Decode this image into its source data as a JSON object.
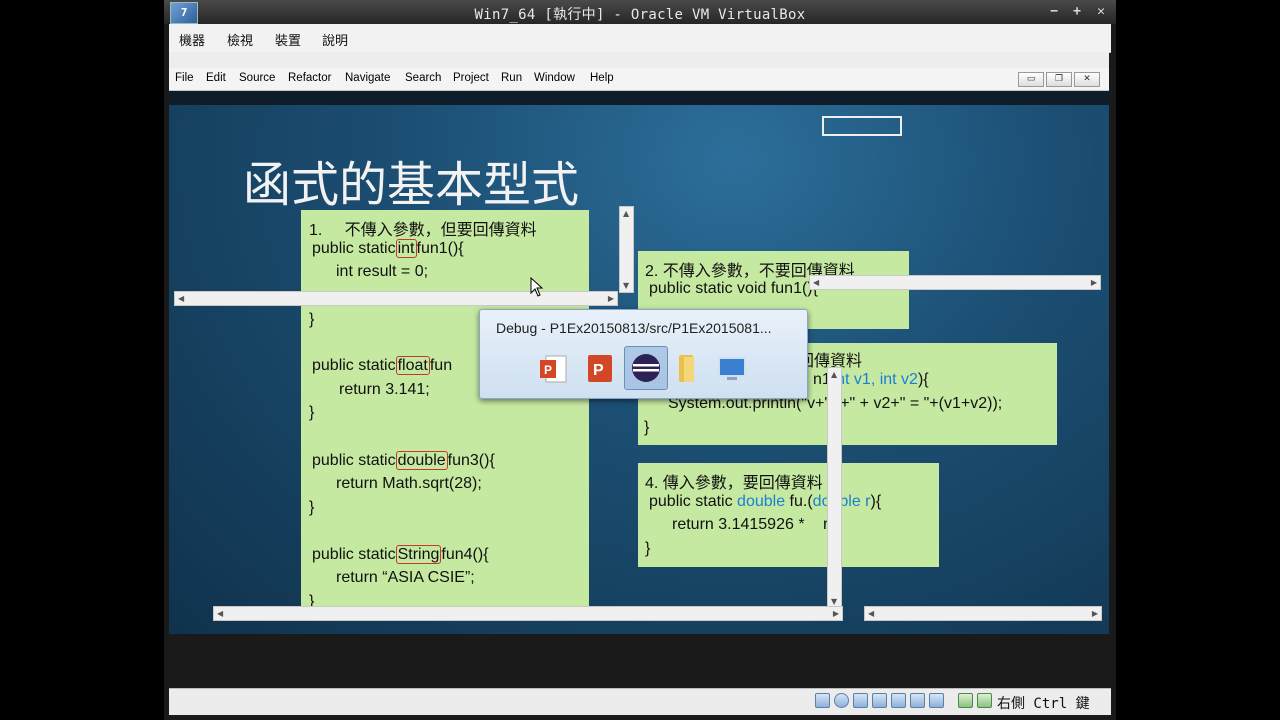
{
  "window": {
    "title": "Win7_64 [執行中] - Oracle VM VirtualBox",
    "icon_label": "7"
  },
  "vbox_menu": [
    "機器",
    "檢視",
    "裝置",
    "說明"
  ],
  "eclipse_menu": [
    "File",
    "Edit",
    "Source",
    "Refactor",
    "Navigate",
    "Search",
    "Project",
    "Run",
    "Window",
    "Help"
  ],
  "slide": {
    "title": "函式的基本型式",
    "box1": {
      "heading": "1.\t不傳入參數，但要回傳資料",
      "lines": [
        {
          "pre": "public static",
          "kw": "int",
          "post": "fun1(){"
        },
        {
          "text": "int result = 0;"
        },
        {
          "text": "}"
        },
        {
          "pre": "public static",
          "kw": "float",
          "post": "fun"
        },
        {
          "text": "return 3.141;"
        },
        {
          "text": "}"
        },
        {
          "pre": "public static",
          "kw": "double",
          "post": "fun3(){"
        },
        {
          "text": "return Math.sqrt(28);"
        },
        {
          "text": "}"
        },
        {
          "pre": "public static",
          "kw": "String",
          "post": "fun4(){"
        },
        {
          "text": "return “ASIA CSIE”;"
        },
        {
          "text": "}"
        }
      ]
    },
    "box2": {
      "heading": "2. 不傳入參數，不要回傳資料",
      "line1": "public static void fun1(){"
    },
    "box3": {
      "heading": "回傳資料",
      "sig_pre": "n1(",
      "sig_mid": "nt v1, int v2",
      "sig_post": "){",
      "body": "System.out.println(\"v",
      "body2": "+\" \"+\" + v2+\" = \"+(v1+v2));",
      "close": "}"
    },
    "box4": {
      "heading": "4. 傳入參數，要回傳資料",
      "sig_pre": "public static ",
      "sig_type": "double",
      "sig_name": " fu",
      "sig_rest": ".(",
      "sig_param": "double r",
      "sig_end": "){",
      "body": "return 3.1415926 *",
      "body_end": "r;",
      "close": "}"
    }
  },
  "popup": {
    "title": "Debug - P1Ex20150813/src/P1Ex2015081...",
    "icons": [
      "powerpoint-icon",
      "powerpoint-icon",
      "eclipse-icon",
      "folder-icon",
      "remote-desktop-icon"
    ]
  },
  "status": {
    "text": "右側 Ctrl 鍵"
  }
}
